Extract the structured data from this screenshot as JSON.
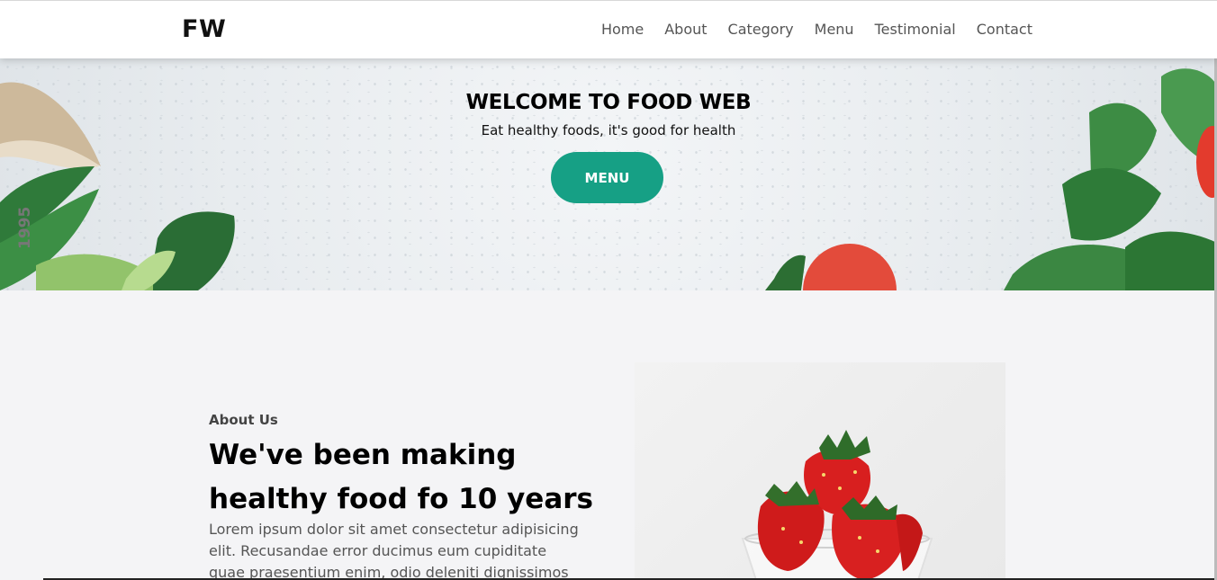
{
  "header": {
    "logo": "FW",
    "nav": [
      "Home",
      "About",
      "Category",
      "Menu",
      "Testimonial",
      "Contact"
    ]
  },
  "hero": {
    "title": "WELCOME TO FOOD WEB",
    "subtitle": "Eat healthy foods, it's good for health",
    "button": "MENU",
    "side_text": "1995"
  },
  "about": {
    "label": "About Us",
    "heading": "We've been making healthy food fo 10 years",
    "text": "Lorem ipsum dolor sit amet consectetur adipisicing elit. Recusandae error ducimus eum cupiditate quae praesentium enim, odio deleniti dignissimos"
  },
  "colors": {
    "accent": "#16a085",
    "background": "#f4f4f6"
  }
}
